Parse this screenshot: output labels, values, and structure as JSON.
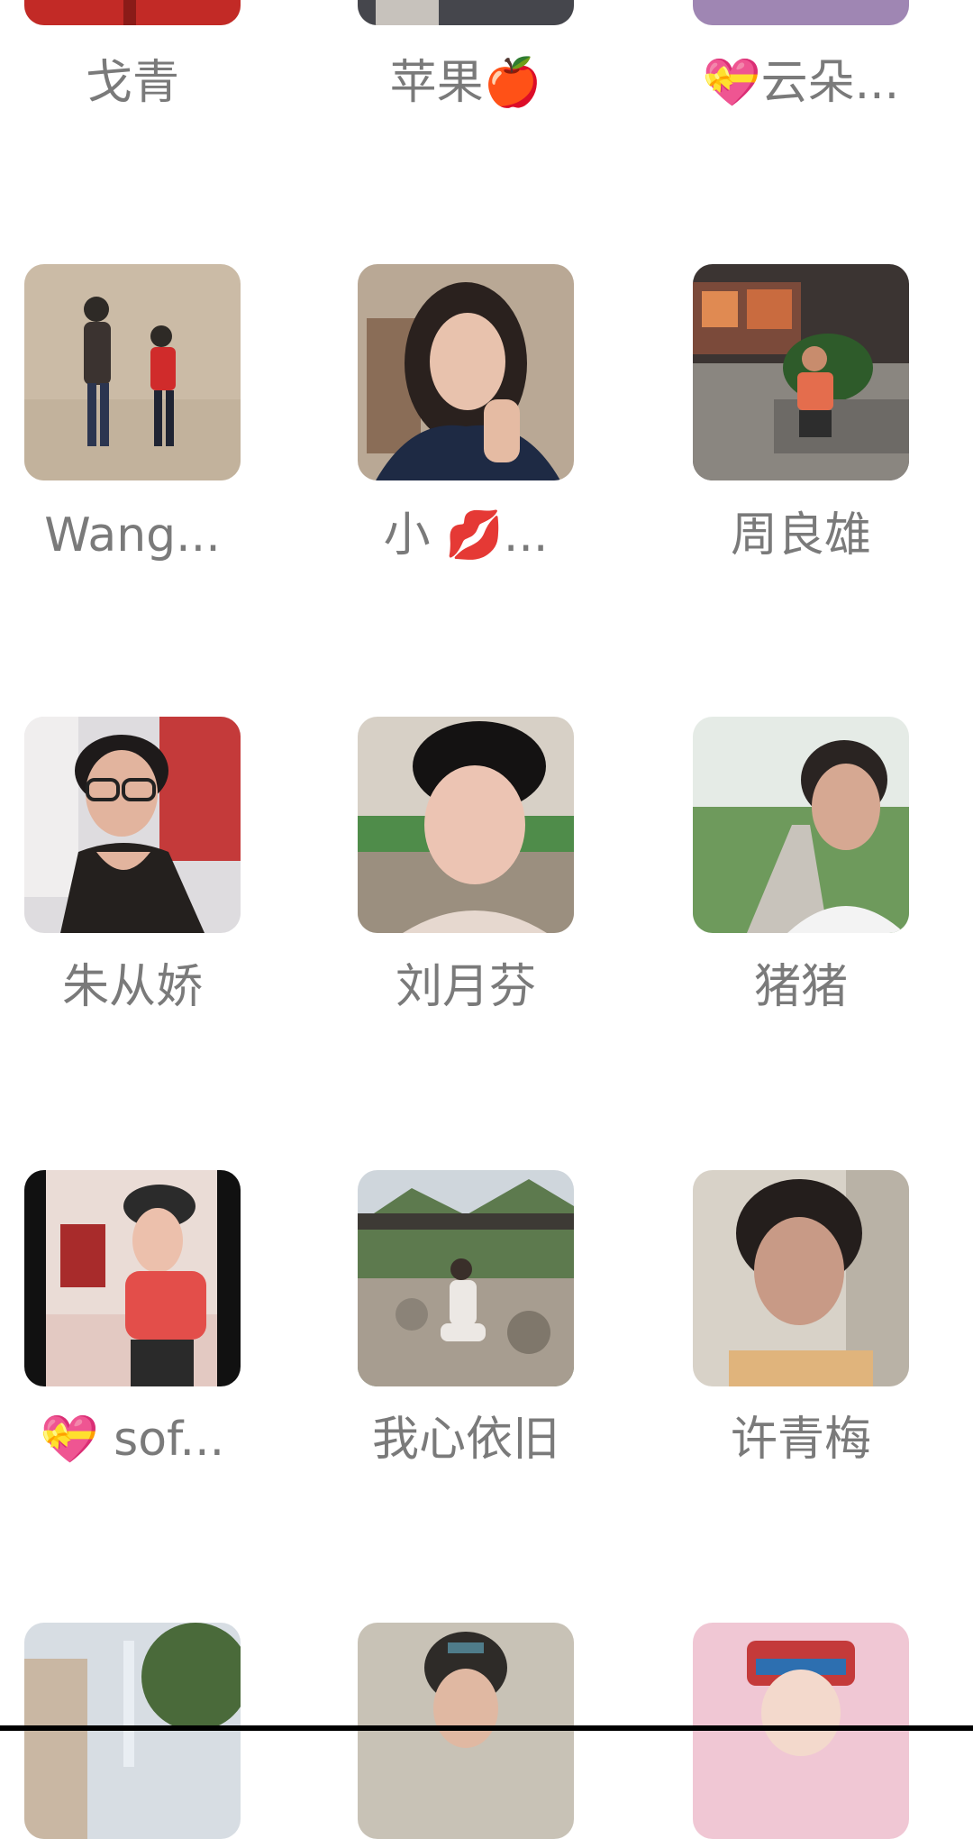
{
  "contacts": [
    {
      "name": "戈青"
    },
    {
      "name": "苹果🍎"
    },
    {
      "name": "💝云朵..."
    },
    {
      "name": "Wang..."
    },
    {
      "name": "小 💋..."
    },
    {
      "name": "周良雄"
    },
    {
      "name": "朱从娇"
    },
    {
      "name": "刘月芬"
    },
    {
      "name": "猪猪"
    },
    {
      "name": "💝 sof..."
    },
    {
      "name": "我心依旧"
    },
    {
      "name": "许青梅"
    },
    {
      "name": ""
    },
    {
      "name": ""
    },
    {
      "name": ""
    }
  ]
}
